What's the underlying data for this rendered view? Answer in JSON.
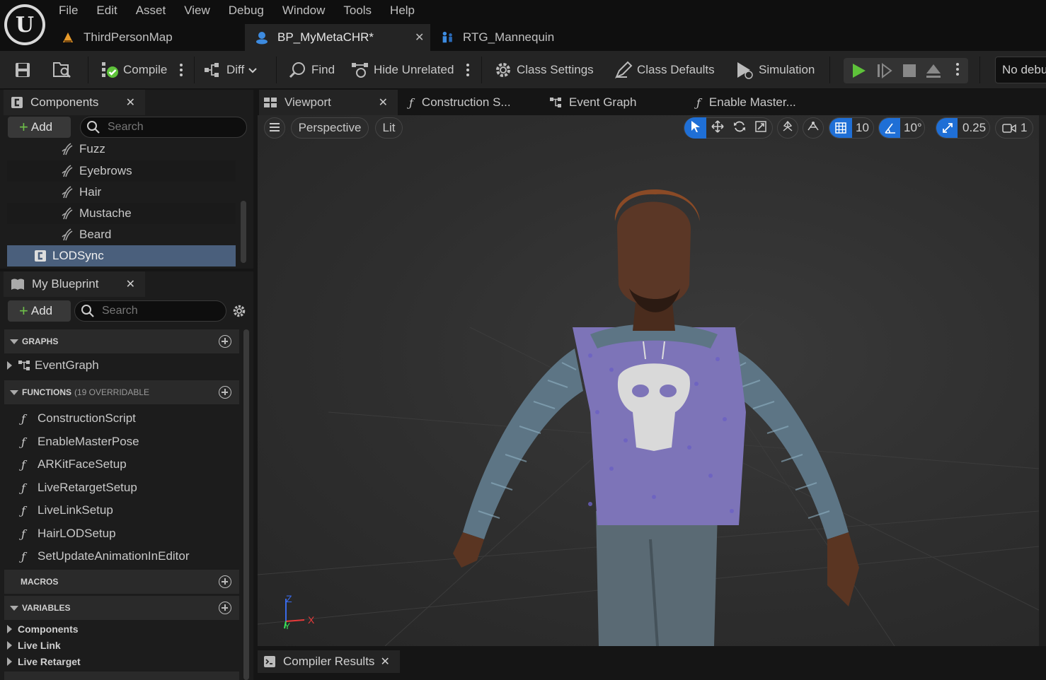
{
  "menu": [
    "File",
    "Edit",
    "Asset",
    "View",
    "Debug",
    "Window",
    "Tools",
    "Help"
  ],
  "doc_tabs": [
    {
      "label": "ThirdPersonMap",
      "icon": "level-icon"
    },
    {
      "label": "BP_MyMetaCHR*",
      "icon": "blueprint-icon",
      "active": true
    },
    {
      "label": "RTG_Mannequin",
      "icon": "retargeter-icon"
    }
  ],
  "toolbar": {
    "compile": "Compile",
    "diff": "Diff",
    "find": "Find",
    "hide_unrelated": "Hide Unrelated",
    "class_settings": "Class Settings",
    "class_defaults": "Class Defaults",
    "simulation": "Simulation",
    "debug_filter": "No debu"
  },
  "components_panel": {
    "title": "Components",
    "add_label": "Add",
    "search_placeholder": "Search",
    "items": [
      "Fuzz",
      "Eyebrows",
      "Hair",
      "Mustache",
      "Beard",
      "LODSync"
    ],
    "selected": "LODSync"
  },
  "my_blueprint": {
    "title": "My Blueprint",
    "add_label": "Add",
    "search_placeholder": "Search",
    "graphs_header": "GRAPHS",
    "graphs": [
      "EventGraph"
    ],
    "functions_header": "FUNCTIONS",
    "functions_note": "(19 OVERRIDABLE",
    "functions": [
      "ConstructionScript",
      "EnableMasterPose",
      "ARKitFaceSetup",
      "LiveRetargetSetup",
      "LiveLinkSetup",
      "HairLODSetup",
      "SetUpdateAnimationInEditor"
    ],
    "macros_header": "MACROS",
    "variables_header": "VARIABLES",
    "variables": [
      "Components",
      "Live Link",
      "Live Retarget"
    ]
  },
  "editor_tabs": [
    {
      "label": "Viewport",
      "active": true
    },
    {
      "label": "Construction S...",
      "icon": "function-icon"
    },
    {
      "label": "Event Graph",
      "icon": "graph-icon"
    },
    {
      "label": "Enable Master...",
      "icon": "function-icon"
    }
  ],
  "viewport": {
    "view_mode": "Perspective",
    "lighting": "Lit",
    "grid_snap": "10",
    "rotation_snap": "10°",
    "scale_snap": "0.25",
    "camera_speed": "1",
    "axis_x": "X",
    "axis_y": "Y",
    "axis_z": "Z"
  },
  "bottom_tab": "Compiler Results",
  "colors": {
    "accent": "#1f6fd6",
    "selection": "#4a5f7c",
    "play": "#5ec23a"
  }
}
